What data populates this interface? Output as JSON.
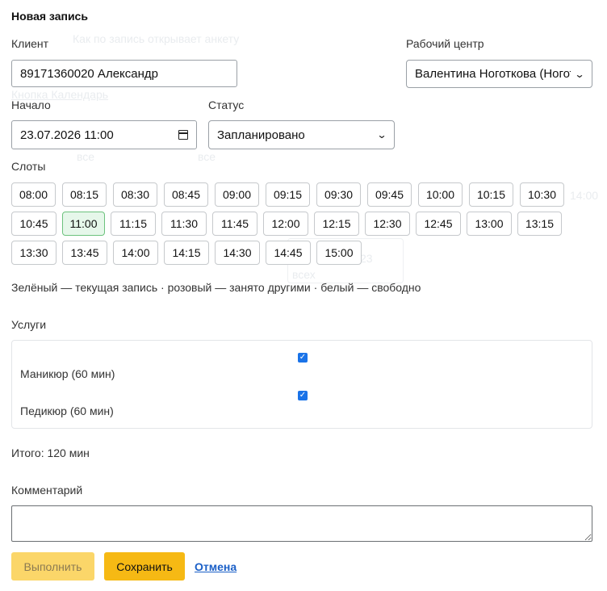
{
  "form": {
    "title": "Новая запись",
    "client_label": "Клиент",
    "client_value": "89171360020 Александр",
    "workplace_label": "Рабочий центр",
    "workplace_value": "Валентина Ноготкова (Ногот",
    "start_label": "Начало",
    "start_value": "23.07.2026 11:00",
    "status_label": "Статус",
    "status_value": "Запланировано",
    "slots_label": "Слоты",
    "slots": [
      {
        "time": "08:00",
        "state": "free"
      },
      {
        "time": "08:15",
        "state": "free"
      },
      {
        "time": "08:30",
        "state": "free"
      },
      {
        "time": "08:45",
        "state": "free"
      },
      {
        "time": "09:00",
        "state": "free"
      },
      {
        "time": "09:15",
        "state": "free"
      },
      {
        "time": "09:30",
        "state": "free"
      },
      {
        "time": "09:45",
        "state": "free"
      },
      {
        "time": "10:00",
        "state": "free"
      },
      {
        "time": "10:15",
        "state": "free"
      },
      {
        "time": "10:30",
        "state": "free"
      },
      {
        "time": "10:45",
        "state": "free"
      },
      {
        "time": "11:00",
        "state": "current"
      },
      {
        "time": "11:15",
        "state": "free"
      },
      {
        "time": "11:30",
        "state": "free"
      },
      {
        "time": "11:45",
        "state": "free"
      },
      {
        "time": "12:00",
        "state": "free"
      },
      {
        "time": "12:15",
        "state": "free"
      },
      {
        "time": "12:30",
        "state": "free"
      },
      {
        "time": "12:45",
        "state": "free"
      },
      {
        "time": "13:00",
        "state": "free"
      },
      {
        "time": "13:15",
        "state": "free"
      },
      {
        "time": "13:30",
        "state": "free"
      },
      {
        "time": "13:45",
        "state": "free"
      },
      {
        "time": "14:00",
        "state": "free"
      },
      {
        "time": "14:15",
        "state": "free"
      },
      {
        "time": "14:30",
        "state": "free"
      },
      {
        "time": "14:45",
        "state": "free"
      },
      {
        "time": "15:00",
        "state": "free"
      }
    ],
    "slots_legend": "Зелёный — текущая запись · розовый — занято другими · белый — свободно",
    "services_label": "Услуги",
    "services": [
      {
        "label": "Маникюр (60 мин)",
        "checked": true
      },
      {
        "label": "Педикюр (60 мин)",
        "checked": true
      }
    ],
    "total_text": "Итого: 120 мин",
    "comment_label": "Комментарий",
    "comment_value": "",
    "done_button": "Выполнить",
    "save_button": "Сохранить",
    "cancel_link": "Отмена"
  },
  "background": {
    "hint_text": "Как по запись открывает анкету",
    "calendar_link": "Кнопка Календарь",
    "filter_1": "все",
    "filter_2": "все",
    "time_text": "14:00",
    "card_number": "23",
    "card_text": "всех"
  },
  "colors": {
    "accent": "#f6b914",
    "accent_disabled": "#fbd669",
    "slot_current": "#e6f7ea",
    "slot_current_border": "#6cc27d",
    "link": "#1a5fc7",
    "checkbox": "#1a73e8"
  }
}
